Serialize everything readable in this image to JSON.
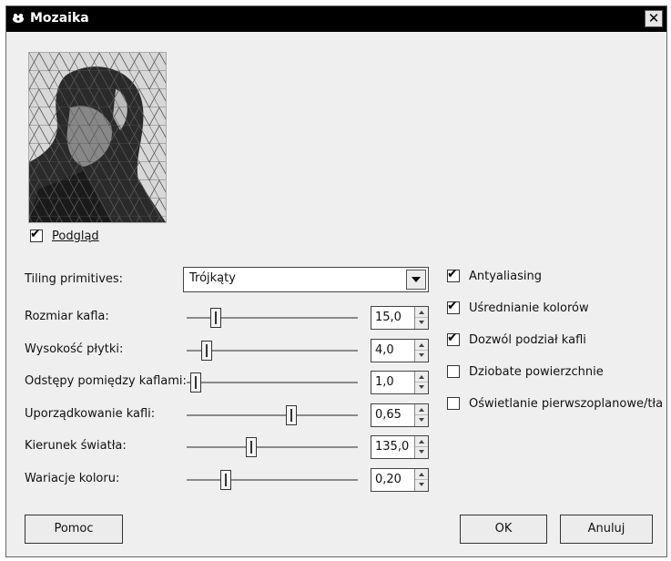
{
  "window": {
    "title": "Mozaika",
    "close_label": "✕"
  },
  "preview_toggle": {
    "label": "Podgląd",
    "checked": true
  },
  "tiling": {
    "label": "Tiling primitives:",
    "selected": "Trójkąty"
  },
  "params": [
    {
      "label": "Rozmiar kafla:",
      "value": "15,0",
      "position": 0.15
    },
    {
      "label": "Wysokość płytki:",
      "value": "4,0",
      "position": 0.09
    },
    {
      "label": "Odstępy pomiędzy kaflami:",
      "value": "1,0",
      "position": 0.02
    },
    {
      "label": "Uporządkowanie kafli:",
      "value": "0,65",
      "position": 0.62
    },
    {
      "label": "Kierunek światła:",
      "value": "135,0",
      "position": 0.37
    },
    {
      "label": "Wariacje koloru:",
      "value": "0,20",
      "position": 0.21
    }
  ],
  "options": [
    {
      "label": "Antyaliasing",
      "checked": true
    },
    {
      "label": "Uśrednianie kolorów",
      "checked": true
    },
    {
      "label": "Dozwól podział kafli",
      "checked": true
    },
    {
      "label": "Dziobate powierzchnie",
      "checked": false
    },
    {
      "label": "Oświetlanie pierwszoplanowe/tła",
      "checked": false
    }
  ],
  "buttons": {
    "help": "Pomoc",
    "ok": "OK",
    "cancel": "Anuluj"
  }
}
